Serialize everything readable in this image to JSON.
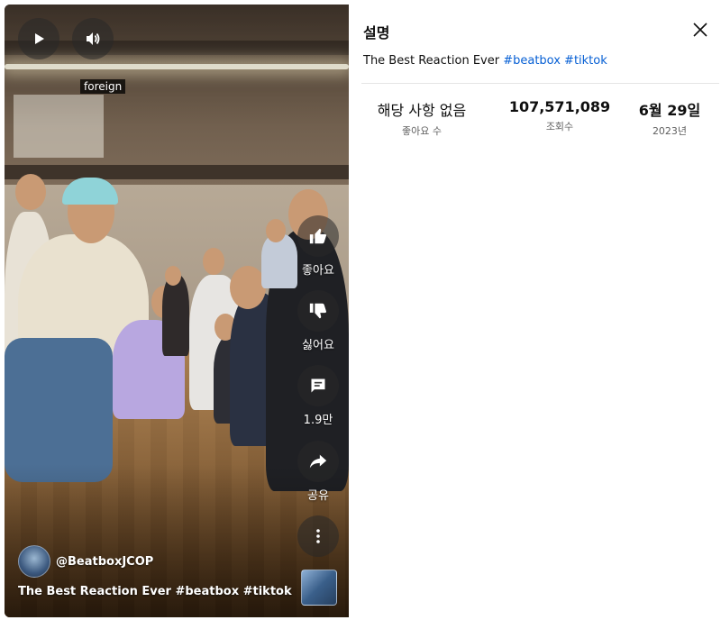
{
  "player": {
    "caption_chip": "foreign",
    "actions": [
      {
        "id": "like",
        "icon": "thumbs-up-icon",
        "label": "좋아요"
      },
      {
        "id": "dislike",
        "icon": "thumbs-down-icon",
        "label": "싫어요"
      },
      {
        "id": "comments",
        "icon": "comment-icon",
        "label": "1.9만"
      },
      {
        "id": "share",
        "icon": "share-icon",
        "label": "공유"
      }
    ],
    "channel_name": "@BeatboxJCOP",
    "title_text": "The Best Reaction Ever ",
    "title_hashtags": "#beatbox #tiktok"
  },
  "panel": {
    "title": "설명",
    "description_text": "The Best Reaction Ever ",
    "description_hashtags": "#beatbox #tiktok",
    "stats": [
      {
        "value": "해당 사항 없음",
        "label": "좋아요 수"
      },
      {
        "value": "107,571,089",
        "label": "조회수"
      },
      {
        "value": "6월 29일",
        "label": "2023년"
      }
    ]
  },
  "colors": {
    "hashtag": "#065fd4",
    "panel_bg": "#ffffff",
    "overlay_button": "rgba(40,40,40,0.55)"
  }
}
